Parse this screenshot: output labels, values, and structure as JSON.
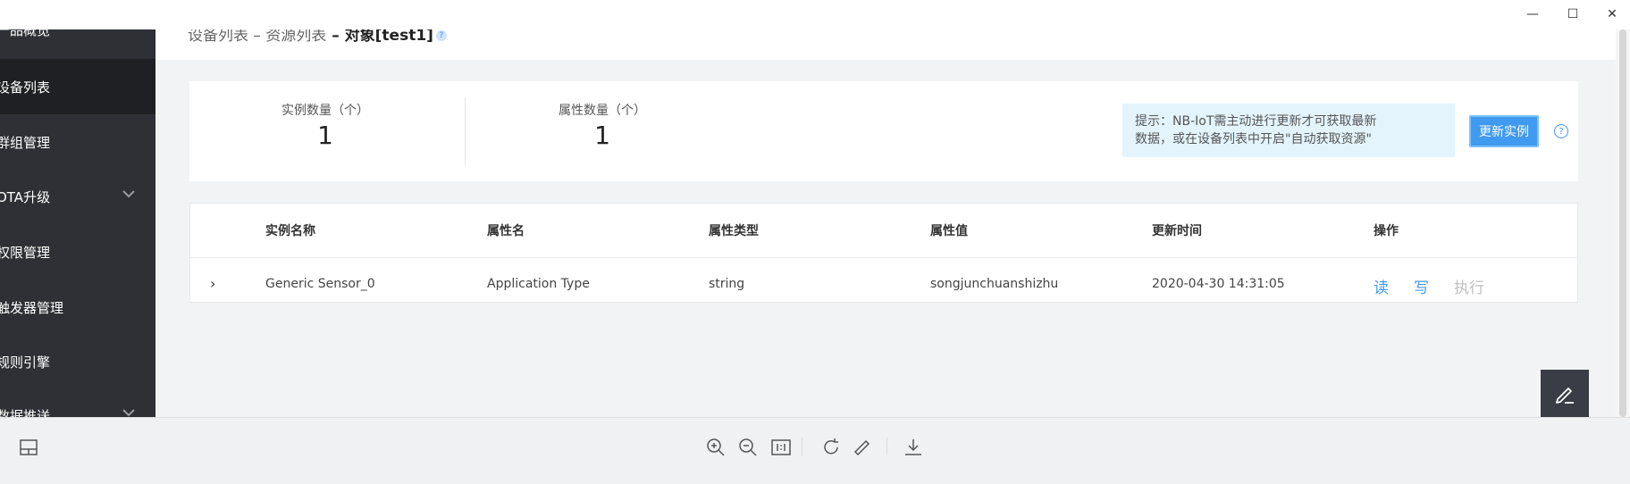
{
  "window": {
    "minimize": "—",
    "maximize": "☐",
    "close": "✕"
  },
  "sidebar": {
    "items": [
      {
        "label": "产品概览"
      },
      {
        "label": "设备列表"
      },
      {
        "label": "群组管理"
      },
      {
        "label": "OTA升级"
      },
      {
        "label": "权限管理"
      },
      {
        "label": "触发器管理"
      },
      {
        "label": "规则引擎"
      },
      {
        "label": "数据推送"
      }
    ]
  },
  "breadcrumb": {
    "part1": "设备列表",
    "sep1": " – ",
    "part2": "资源列表",
    "sep2": " – ",
    "current": "对象[test1]",
    "help": "?"
  },
  "stats": {
    "instance_label": "实例数量（个）",
    "instance_value": "1",
    "attr_label": "属性数量（个）",
    "attr_value": "1"
  },
  "tip": {
    "line1": "提示：NB-IoT需主动进行更新才可获取最新",
    "line2": "数据，或在设备列表中开启\"自动获取资源\""
  },
  "refresh_button": "更新实例",
  "help_icon": "?",
  "table": {
    "headers": [
      "实例名称",
      "属性名",
      "属性类型",
      "属性值",
      "更新时间",
      "操作"
    ],
    "rows": [
      {
        "expand": "›",
        "instance": "Generic Sensor_0",
        "attr_name": "Application Type",
        "attr_type": "string",
        "attr_value": "songjunchuanshizhu",
        "updated": "2020-04-30 14:31:05",
        "actions": {
          "read": "读",
          "write": "写",
          "execute": "执行"
        }
      }
    ]
  },
  "colors": {
    "accent": "#3f9af0",
    "sidebar_bg": "#2f3035",
    "disabled": "#c0c0c0"
  }
}
